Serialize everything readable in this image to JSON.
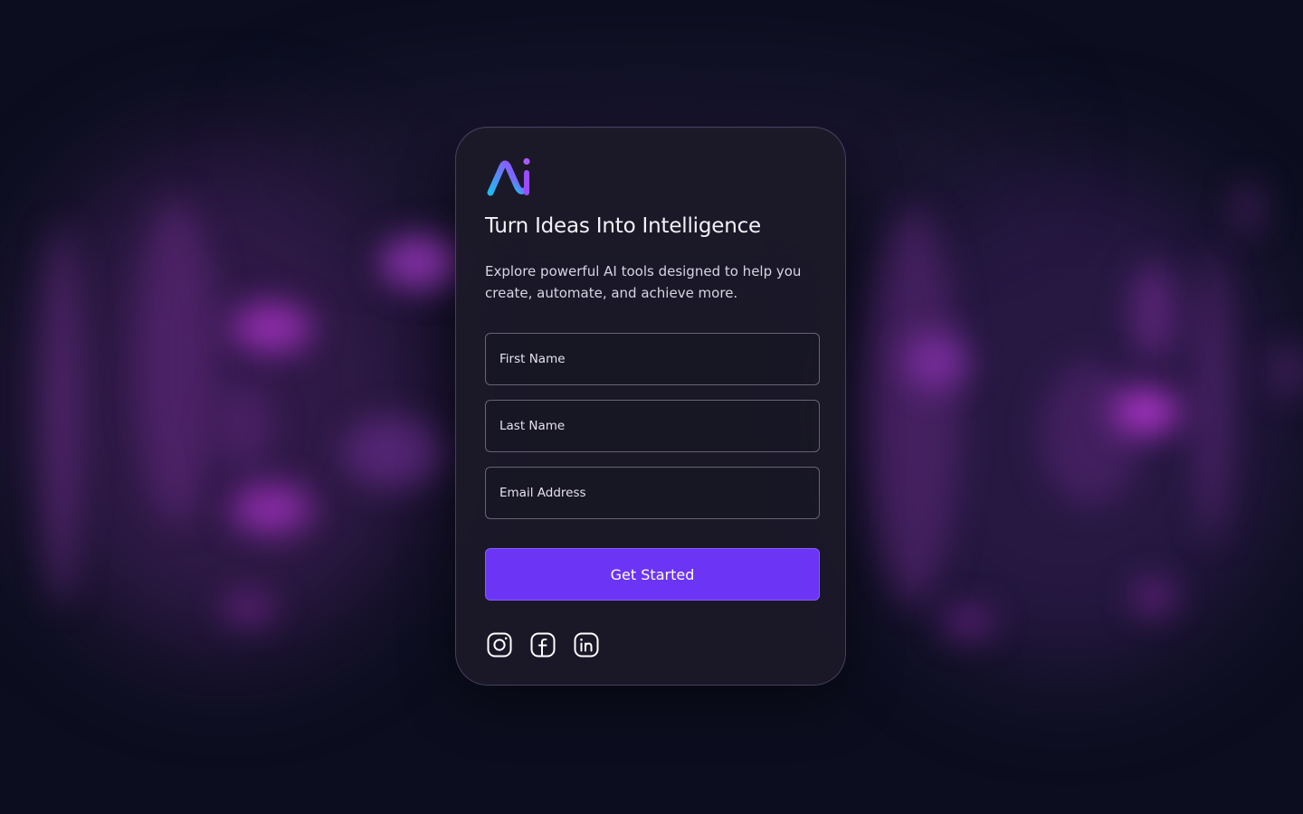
{
  "brand": {
    "logo_text": "Ai",
    "gradient_start": "#22b8f2",
    "gradient_end": "#9b4dff"
  },
  "hero": {
    "title": "Turn Ideas Into Intelligence",
    "subtitle": "Explore powerful AI tools designed to help you create, automate, and achieve more."
  },
  "form": {
    "first_name_placeholder": "First Name",
    "last_name_placeholder": "Last Name",
    "email_placeholder": "Email Address",
    "submit_label": "Get Started"
  },
  "socials": [
    {
      "icon": "instagram-icon"
    },
    {
      "icon": "facebook-icon"
    },
    {
      "icon": "linkedin-icon"
    }
  ],
  "colors": {
    "background": "#0c0e1f",
    "accent": "#6c35f5",
    "card": "#1c1a28"
  }
}
